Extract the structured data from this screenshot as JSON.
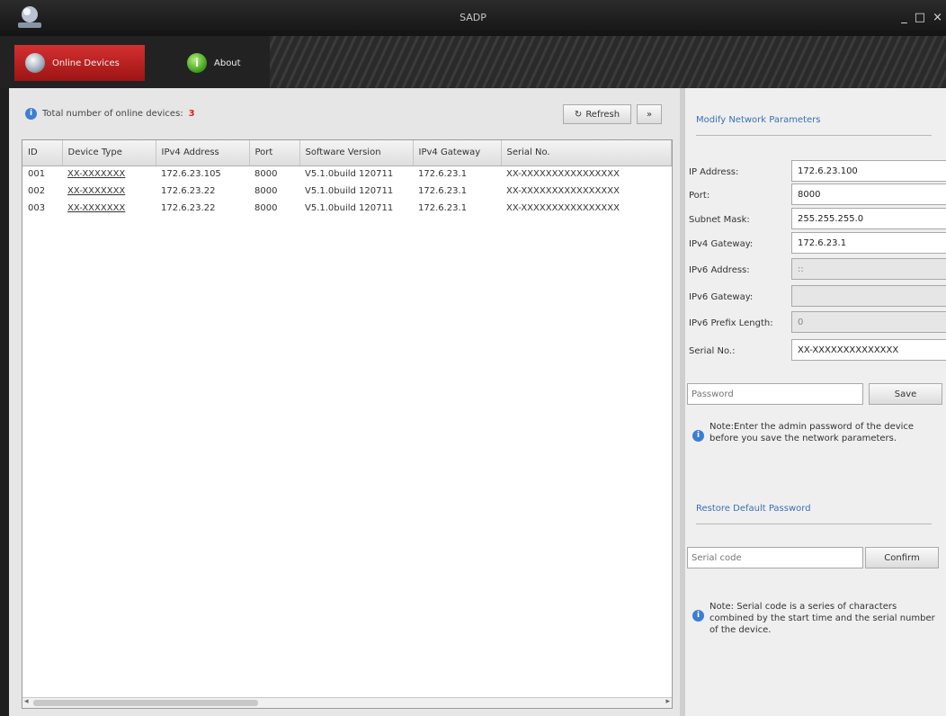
{
  "window": {
    "title": "SADP",
    "controls": [
      "_",
      "□",
      "×"
    ]
  },
  "tabs": [
    {
      "label": "Online Devices",
      "icon": "online-devices-icon",
      "active": true
    },
    {
      "label": "About",
      "icon": "about-icon",
      "active": false
    }
  ],
  "device_list": {
    "total_prefix": "Total number of online devices:",
    "total_count": "3",
    "refresh_label": "Refresh",
    "expand_label": "»",
    "columns": [
      "ID",
      "Device Type",
      "IPv4 Address",
      "Port",
      "Software Version",
      "IPv4 Gateway",
      "Serial No."
    ],
    "rows": [
      [
        "001",
        "XX-XXXXXXX",
        "172.6.23.105",
        "8000",
        "V5.1.0build 120711",
        "172.6.23.1",
        "XX-XXXXXXXXXXXXXXXX"
      ],
      [
        "002",
        "XX-XXXXXXX",
        "172.6.23.22",
        "8000",
        "V5.1.0build 120711",
        "172.6.23.1",
        "XX-XXXXXXXXXXXXXXXX"
      ],
      [
        "003",
        "XX-XXXXXXX",
        "172.6.23.22",
        "8000",
        "V5.1.0build 120711",
        "172.6.23.1",
        "XX-XXXXXXXXXXXXXXXX"
      ]
    ]
  },
  "modify_panel": {
    "title": "Modify Network Parameters",
    "fields": [
      {
        "label": "IP Address:",
        "value": "172.6.23.100",
        "disabled": false
      },
      {
        "label": "Port:",
        "value": "8000",
        "disabled": false
      },
      {
        "label": "Subnet Mask:",
        "value": "255.255.255.0",
        "disabled": false
      },
      {
        "label": "IPv4 Gateway:",
        "value": "172.6.23.1",
        "disabled": false
      },
      {
        "label": "IPv6 Address:",
        "value": "::",
        "disabled": true
      },
      {
        "label": "IPv6 Gateway:",
        "value": "",
        "disabled": true
      },
      {
        "label": "IPv6 Prefix Length:",
        "value": "0",
        "disabled": true
      },
      {
        "label": "Serial No.:",
        "value": "XX-XXXXXXXXXXXXXX",
        "disabled": false
      }
    ],
    "password_placeholder": "Password",
    "save_label": "Save",
    "note": "Note:Enter the admin password of the device before you save the network parameters."
  },
  "restore_panel": {
    "title": "Restore Default Password",
    "code_placeholder": "Serial code",
    "confirm_label": "Confirm",
    "note": "Note: Serial code is a series of characters combined by the start time and the serial number of the device."
  }
}
